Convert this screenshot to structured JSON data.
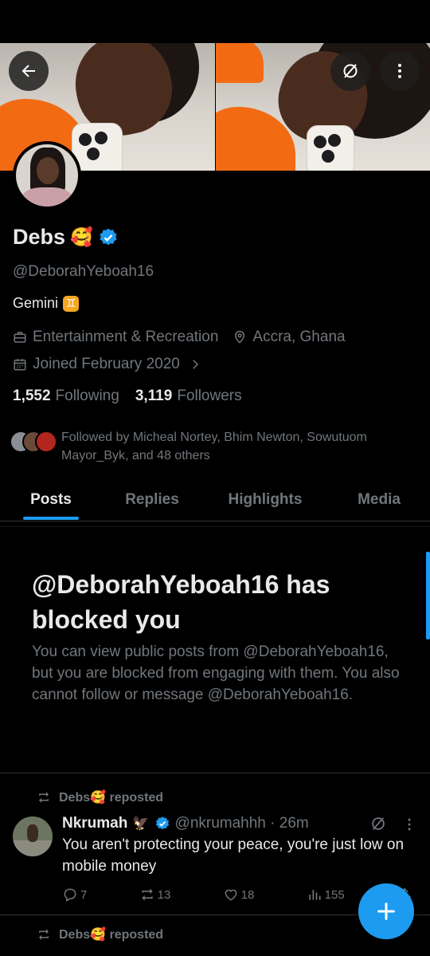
{
  "profile": {
    "display_name": "Debs",
    "name_emoji": "🥰",
    "handle": "@DeborahYeboah16",
    "bio": "Gemini",
    "bio_emoji": "♊",
    "category": "Entertainment & Recreation",
    "location": "Accra, Ghana",
    "joined": "Joined February 2020",
    "following_count": "1,552",
    "following_label": "Following",
    "followers_count": "3,119",
    "followers_label": "Followers",
    "followed_by": "Followed by Micheal Nortey, Bhim Newton, Sowutuom Mayor_Byk, and 48 others"
  },
  "tabs": [
    {
      "label": "Posts",
      "active": true
    },
    {
      "label": "Replies",
      "active": false
    },
    {
      "label": "Highlights",
      "active": false
    },
    {
      "label": "Media",
      "active": false
    }
  ],
  "blocked_notice": {
    "title": "@DeborahYeboah16 has blocked you",
    "body": "You can view public posts from @DeborahYeboah16, but you are blocked from engaging with them. You also cannot follow or message @DeborahYeboah16."
  },
  "posts": [
    {
      "repost_by": "Debs",
      "repost_emoji": "🥰",
      "repost_suffix": "reposted",
      "author": "Nkrumah",
      "author_emoji": "🦅",
      "handle_time": "@nkrumahhh · 26m",
      "text": "You aren't protecting your peace, you're just low on mobile money",
      "replies": "7",
      "reposts": "13",
      "likes": "18",
      "views": "155"
    },
    {
      "repost_by": "Debs",
      "repost_emoji": "🥰",
      "repost_suffix": "reposted"
    }
  ],
  "colors": {
    "background": "#000000",
    "accent": "#1d9bf0",
    "text_primary": "#e7e9ea",
    "text_secondary": "#71767b",
    "divider": "#2f3336"
  },
  "icons": {
    "back": "arrow-left-icon",
    "grok": "grok-icon",
    "more": "more-vertical-icon",
    "verified": "verified-badge-icon",
    "category": "briefcase-icon",
    "location": "location-pin-icon",
    "joined": "calendar-icon",
    "compose": "plus-icon"
  }
}
